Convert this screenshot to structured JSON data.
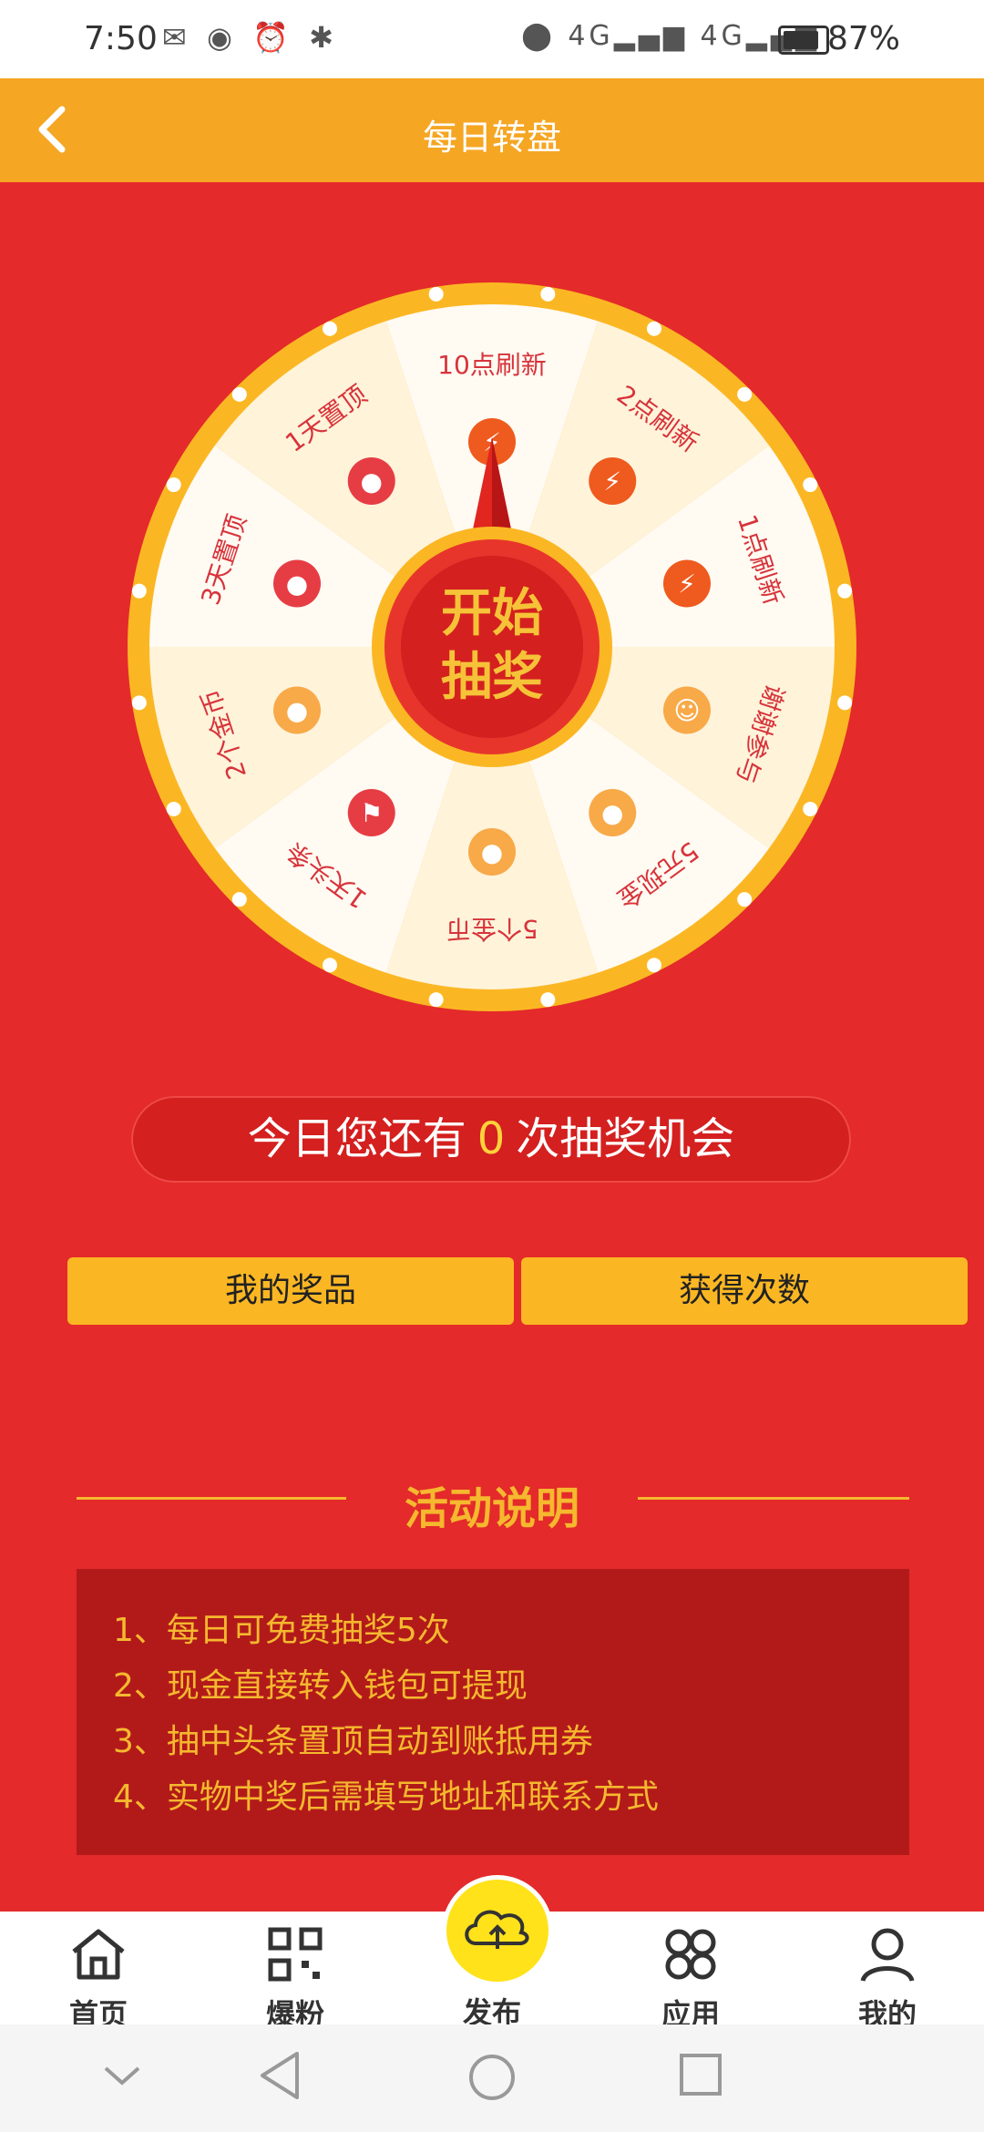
{
  "status_bar": {
    "time": "7:50",
    "network_1": "4G",
    "network_2": "4G",
    "battery": "87%"
  },
  "app_bar": {
    "title": "每日转盘"
  },
  "wheel": {
    "center_line1": "开始",
    "center_line2": "抽奖",
    "segments": [
      {
        "label": "10点刷新",
        "icon": "lightning-icon"
      },
      {
        "label": "2点刷新",
        "icon": "lightning-icon"
      },
      {
        "label": "1点刷新",
        "icon": "lightning-icon"
      },
      {
        "label": "谢谢参与",
        "icon": "smiley-icon"
      },
      {
        "label": "5元现金",
        "icon": "cash-icon"
      },
      {
        "label": "5个金币",
        "icon": "coin-icon"
      },
      {
        "label": "1天头条",
        "icon": "flag-icon"
      },
      {
        "label": "2个金币",
        "icon": "coin-icon"
      },
      {
        "label": "3天置顶",
        "icon": "pin-icon"
      },
      {
        "label": "1天置顶",
        "icon": "pin-icon"
      }
    ],
    "colors": {
      "rim": "#fbb723",
      "light": "#fff3da",
      "white": "#fffaf2",
      "hub": "#d4201f",
      "hub_text": "#f6c338"
    }
  },
  "chances": {
    "prefix": "今日您还有",
    "count": "0",
    "suffix": "次抽奖机会"
  },
  "buttons": {
    "my_prizes": "我的奖品",
    "get_chances": "获得次数"
  },
  "activity": {
    "title": "活动说明",
    "rules": [
      "1、每日可免费抽奖5次",
      "2、现金直接转入钱包可提现",
      "3、抽中头条置顶自动到账抵用券",
      "4、实物中奖后需填写地址和联系方式"
    ]
  },
  "bottom_nav": {
    "items": [
      {
        "label": "首页",
        "icon": "home-icon"
      },
      {
        "label": "爆粉",
        "icon": "qr-icon"
      },
      {
        "label": "发布",
        "icon": "upload-cloud-icon"
      },
      {
        "label": "应用",
        "icon": "apps-icon"
      },
      {
        "label": "我的",
        "icon": "user-icon"
      }
    ]
  }
}
